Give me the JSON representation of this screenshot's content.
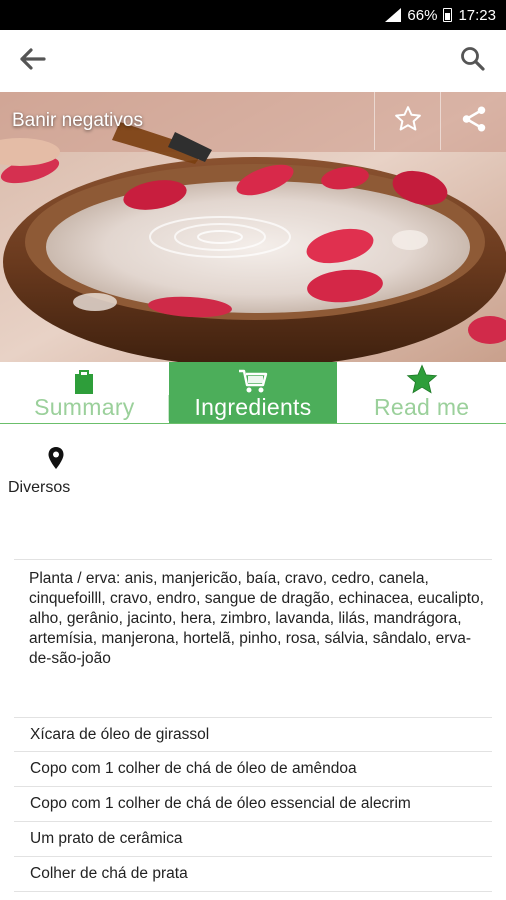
{
  "status_bar": {
    "battery": "66%",
    "time": "17:23"
  },
  "toolbar": {
    "back_icon": "arrow-left-icon",
    "search_icon": "search-icon"
  },
  "hero": {
    "title": "Banir negativos",
    "favorite_icon": "star-outline-icon",
    "share_icon": "share-icon"
  },
  "tabs": [
    {
      "label": "Summary",
      "icon": "clipboard-icon",
      "active": false
    },
    {
      "label": "Ingredients",
      "icon": "cart-icon",
      "active": true
    },
    {
      "label": "Read me",
      "icon": "star-icon",
      "active": false
    }
  ],
  "location": {
    "icon": "map-pin-icon",
    "label": "Diversos"
  },
  "plants": {
    "text": "Planta / erva: anis, manjericão, baía, cravo, cedro, canela, cinquefoilll, cravo, endro, sangue de dragão, echinacea, eucalipto, alho, gerânio, jacinto, hera, zimbro, lavanda, lilás, mandrágora, artemísia, manjerona, hortelã, pinho, rosa, sálvia, sândalo, erva-de-são-joão"
  },
  "ingredients": [
    "Xícara de óleo de girassol",
    "Copo com 1 colher de chá de óleo de amêndoa",
    "Copo com 1 colher de chá de óleo essencial de alecrim",
    "Um prato de cerâmica",
    "Colher de chá de prata"
  ],
  "colors": {
    "accent_green": "#4cae5a",
    "inactive_tab_text": "#9bd09b",
    "icon_green": "#2e9e3a"
  }
}
